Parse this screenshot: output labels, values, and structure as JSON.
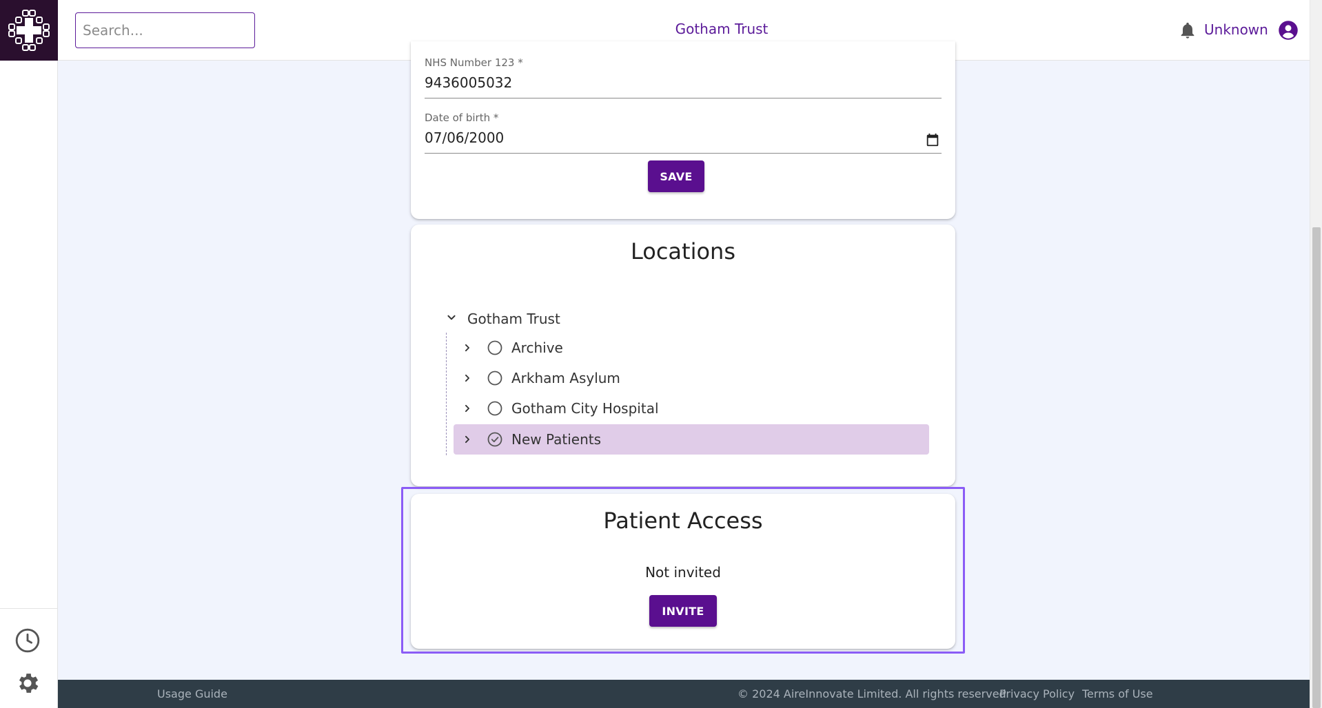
{
  "header": {
    "search_placeholder": "Search...",
    "org_title": "Gotham Trust",
    "user_name": "Unknown"
  },
  "patient_form": {
    "nhs_label": "NHS Number 123 *",
    "nhs_value": "9436005032",
    "dob_label": "Date of birth *",
    "dob_value": "07/06/2000",
    "save_label": "SAVE"
  },
  "locations": {
    "title": "Locations",
    "root": "Gotham Trust",
    "items": [
      {
        "label": "Archive",
        "selected": false
      },
      {
        "label": "Arkham Asylum",
        "selected": false
      },
      {
        "label": "Gotham City Hospital",
        "selected": false
      },
      {
        "label": "New Patients",
        "selected": true
      }
    ]
  },
  "patient_access": {
    "title": "Patient Access",
    "status": "Not invited",
    "invite_label": "INVITE"
  },
  "footer": {
    "usage_guide": "Usage Guide",
    "copyright": "© 2024 AireInnovate Limited. All rights reserved",
    "privacy": "Privacy Policy",
    "terms": "Terms of Use"
  },
  "colors": {
    "brand": "#5a0f8f",
    "selected_bg": "#e0cce8",
    "footer_bg": "#2f3d47",
    "logo_bg": "#2a0f2e",
    "highlight": "#8b5cf6"
  }
}
